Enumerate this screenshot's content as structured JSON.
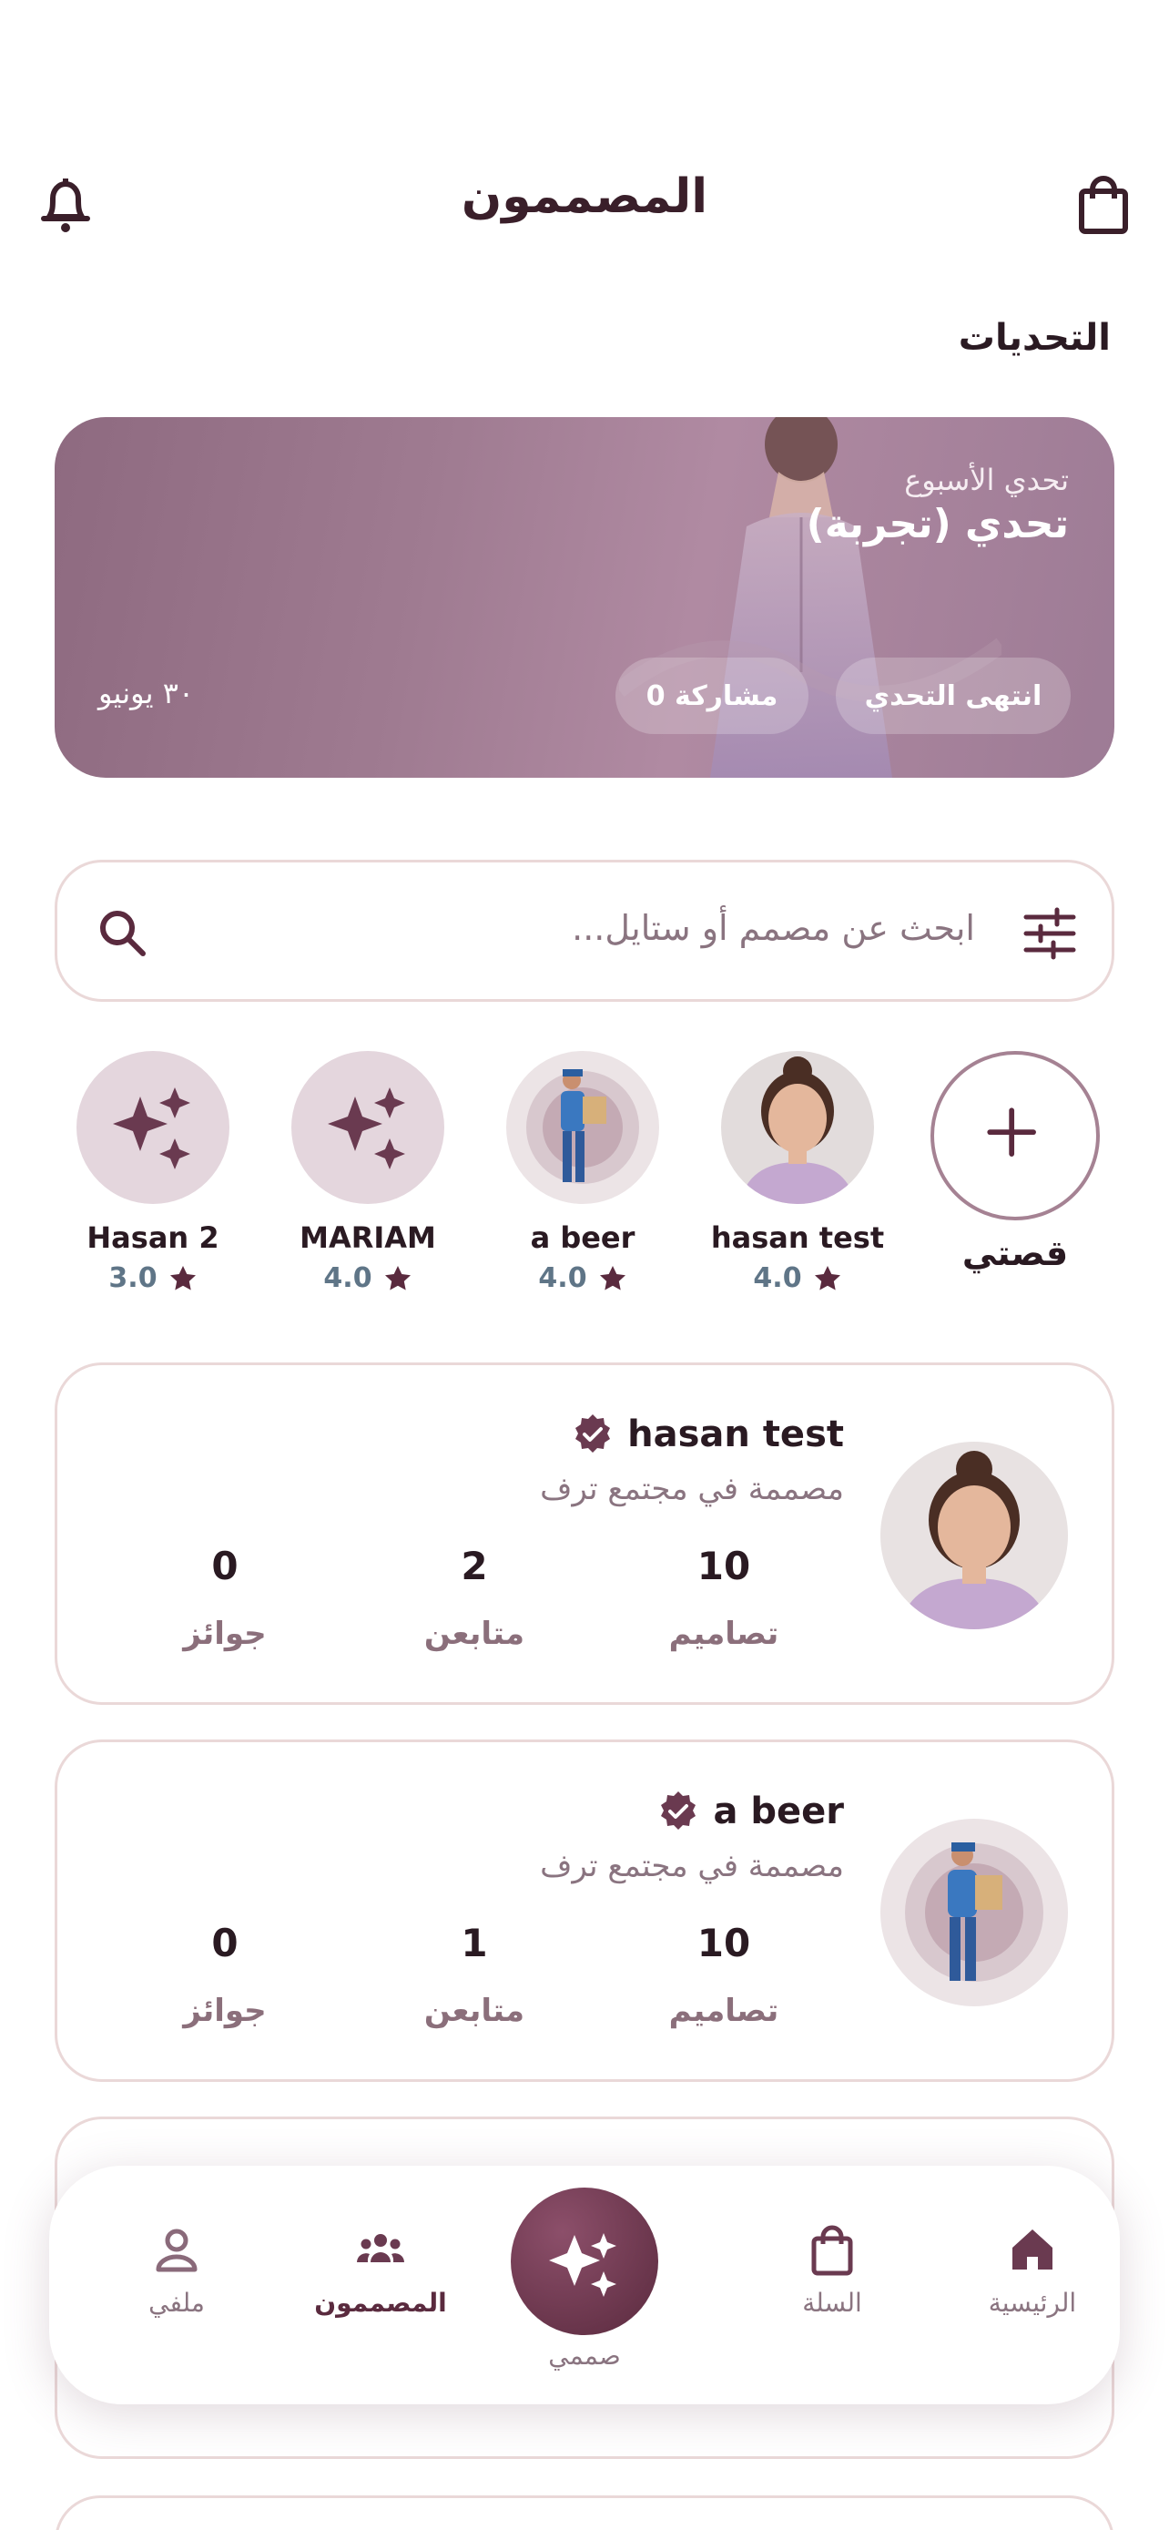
{
  "header": {
    "title": "المصممون"
  },
  "section": {
    "challenges_title": "التحديات"
  },
  "challenge": {
    "subtitle": "تحدي الأسبوع",
    "title": "تحدي (تجربة)",
    "status": "انتهى التحدي",
    "participants": "0 مشاركة",
    "date": "٣٠ يونيو"
  },
  "search": {
    "placeholder": "ابحث عن مصمم أو ستايل..."
  },
  "stories": {
    "add_label": "قصتي",
    "items": [
      {
        "name": "hasan test",
        "rating": "4.0"
      },
      {
        "name": "a beer",
        "rating": "4.0"
      },
      {
        "name": "MARIAM",
        "rating": "4.0"
      },
      {
        "name": "Hasan 2",
        "rating": "3.0"
      }
    ]
  },
  "designers": [
    {
      "name": "hasan test",
      "role": "مصممة في مجتمع ترف",
      "designs": "10",
      "designs_label": "تصاميم",
      "followers": "2",
      "followers_label": "متابعن",
      "awards": "0",
      "awards_label": "جوائز"
    },
    {
      "name": "a beer",
      "role": "مصممة في مجتمع ترف",
      "designs": "10",
      "designs_label": "تصاميم",
      "followers": "1",
      "followers_label": "متابعن",
      "awards": "0",
      "awards_label": "جوائز"
    }
  ],
  "nav": {
    "home": "الرئيسية",
    "cart": "السلة",
    "design": "صممي",
    "designers": "المصممون",
    "profile": "ملفي"
  },
  "colors": {
    "accent": "#5a2a3e",
    "card_border": "#ead8d8",
    "rating": "#5f7587"
  }
}
